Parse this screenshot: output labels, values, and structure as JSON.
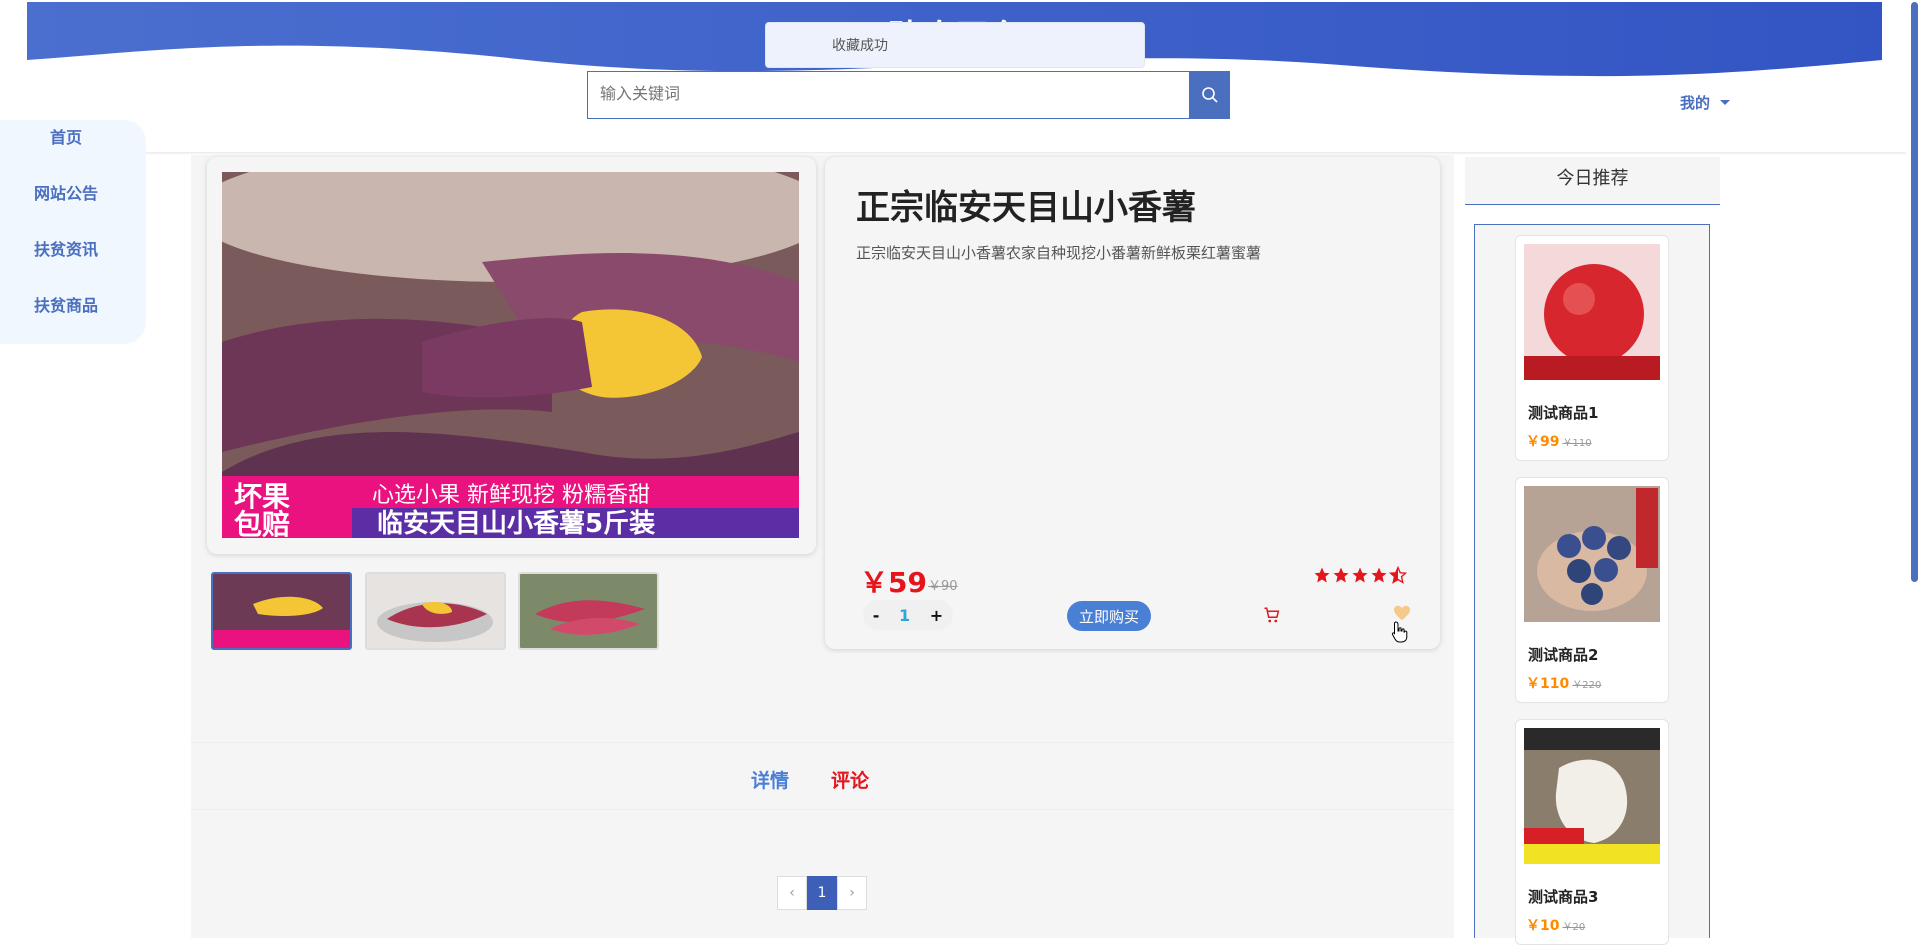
{
  "header": {
    "site_title": "助农平台",
    "search_placeholder": "输入关键词",
    "user_menu": "我的"
  },
  "toast": {
    "message": "收藏成功"
  },
  "sidebar": {
    "items": [
      {
        "label": "首页"
      },
      {
        "label": "网站公告"
      },
      {
        "label": "扶贫资讯"
      },
      {
        "label": "扶贫商品"
      }
    ]
  },
  "product": {
    "title": "正宗临安天目山小香薯",
    "description": "正宗临安天目山小香薯农家自种现挖小番薯新鲜板栗红薯蜜薯",
    "price": "￥59",
    "original_price": "￥90",
    "rating": 4.5,
    "quantity": "1",
    "qty_minus": "-",
    "qty_plus": "+",
    "buy_label": "立即购买",
    "image_text": {
      "badge_line1": "坏果",
      "badge_line2": "包赔",
      "banner_top": "心选小果 新鲜现挖 粉糯香甜",
      "banner_bottom": "临安天目山小香薯5斤装"
    }
  },
  "tabs": [
    {
      "label": "详情",
      "color": "#4a7fd6"
    },
    {
      "label": "评论",
      "color": "#e4151c"
    }
  ],
  "pager": {
    "prev": "‹",
    "current": "1",
    "next": "›"
  },
  "recommend": {
    "title": "今日推荐",
    "items": [
      {
        "name": "测试商品1",
        "price": "￥99",
        "original": "￥110"
      },
      {
        "name": "测试商品2",
        "price": "￥110",
        "original": "￥220"
      },
      {
        "name": "测试商品3",
        "price": "￥10",
        "original": "￥20"
      }
    ]
  },
  "colors": {
    "accent": "#4a6fbf",
    "price_red": "#e4151c",
    "rec_orange": "#ff8a00"
  }
}
